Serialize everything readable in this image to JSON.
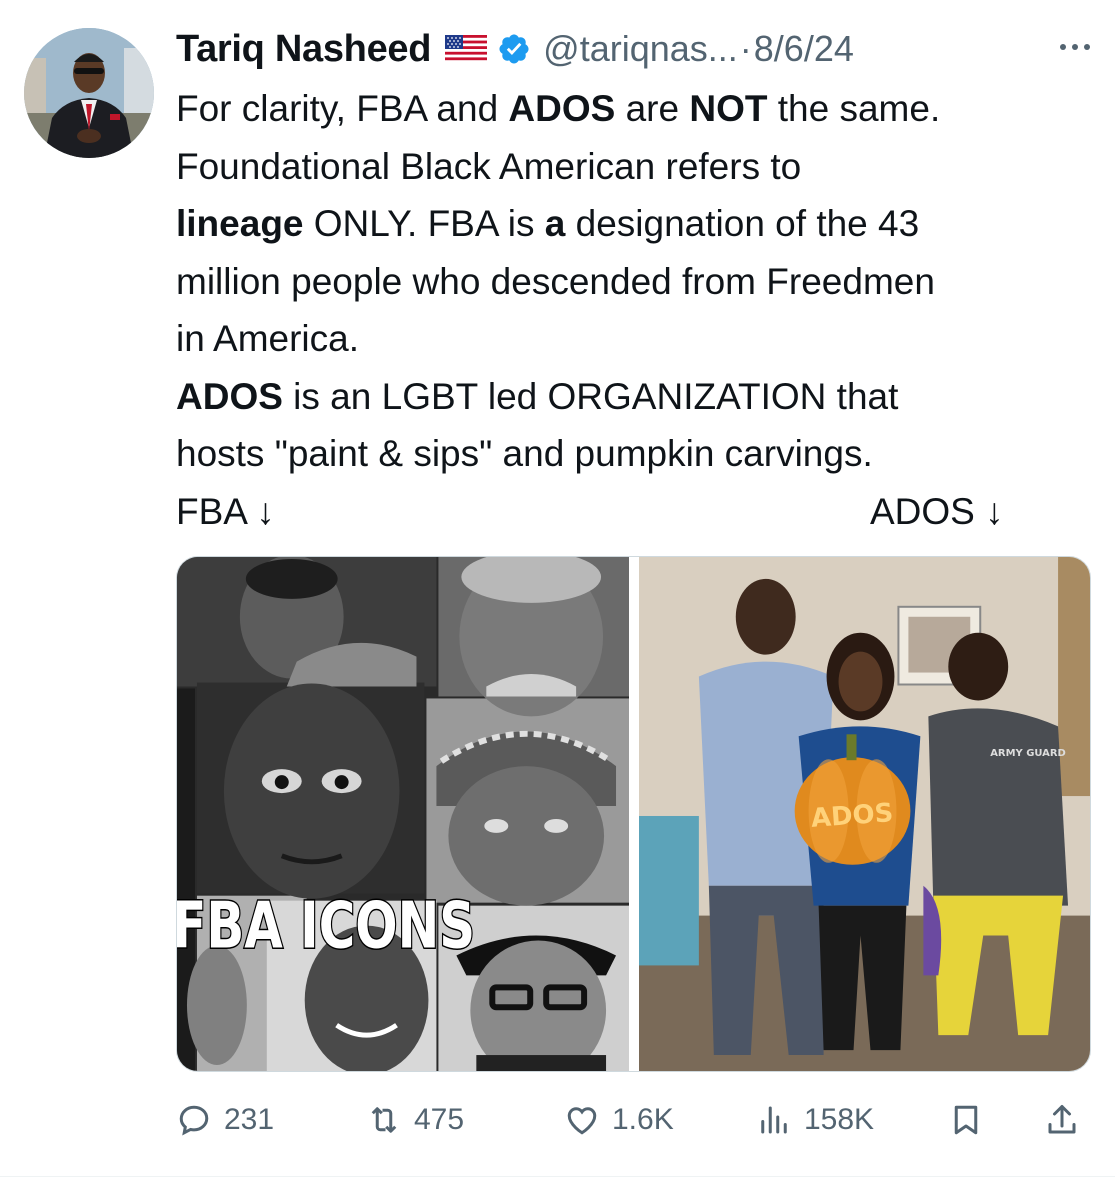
{
  "author": {
    "name": "Tariq Nasheed",
    "flag_emoji": "🇺🇸",
    "handle": "@tariqnas...",
    "separator": "·",
    "date": "8/6/24"
  },
  "tweet": {
    "lines": [
      [
        {
          "t": "For clarity, FBA and ",
          "b": false
        },
        {
          "t": "ADOS",
          "b": true
        },
        {
          "t": " are ",
          "b": false
        },
        {
          "t": "NOT",
          "b": true
        },
        {
          "t": " the same.",
          "b": false
        }
      ],
      [
        {
          "t": "Foundational Black American refers to",
          "b": false
        }
      ],
      [
        {
          "t": "lineage",
          "b": true
        },
        {
          "t": " ONLY. FBA is ",
          "b": false
        },
        {
          "t": "a",
          "b": true
        },
        {
          "t": " designation of the 43",
          "b": false
        }
      ],
      [
        {
          "t": "million people who descended from Freedmen",
          "b": false
        }
      ],
      [
        {
          "t": "in America.",
          "b": false
        }
      ],
      [
        {
          "t": "ADOS",
          "b": true
        },
        {
          "t": " is an LGBT led ORGANIZATION that",
          "b": false
        }
      ],
      [
        {
          "t": "hosts \"paint & sips\" and pumpkin carvings.",
          "b": false
        }
      ]
    ],
    "arrow_left": "FBA ↓",
    "arrow_right": "ADOS ↓"
  },
  "media": {
    "left_caption": "FBA ICONS",
    "pumpkin_text": "ADOS",
    "shirt_text": "ARMY GUARD"
  },
  "actions": {
    "replies": "231",
    "reposts": "475",
    "likes": "1.6K",
    "views": "158K"
  },
  "colors": {
    "text": "#0f1419",
    "secondary": "#536471",
    "verified": "#1d9bf0"
  },
  "icons": [
    "verified-badge-icon",
    "more-icon",
    "reply-icon",
    "repost-icon",
    "like-icon",
    "views-icon",
    "bookmark-icon",
    "share-icon"
  ]
}
